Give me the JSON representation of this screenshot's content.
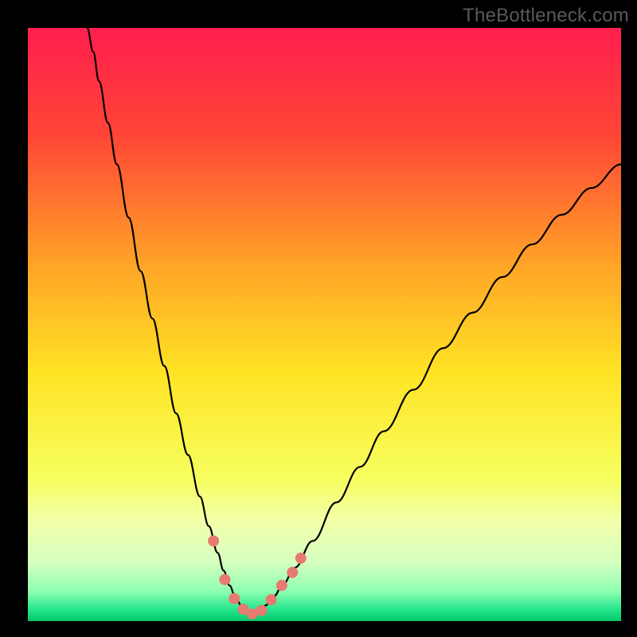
{
  "watermark": {
    "text": "TheBottleneck.com"
  },
  "chart_data": {
    "type": "line",
    "title": "",
    "xlabel": "",
    "ylabel": "",
    "xlim": [
      0,
      100
    ],
    "ylim": [
      0,
      100
    ],
    "gradient_stops": [
      {
        "offset": 0.0,
        "color": "#ff1e4e"
      },
      {
        "offset": 0.18,
        "color": "#ff4536"
      },
      {
        "offset": 0.4,
        "color": "#ffa427"
      },
      {
        "offset": 0.58,
        "color": "#ffe324"
      },
      {
        "offset": 0.76,
        "color": "#f7ff5f"
      },
      {
        "offset": 0.83,
        "color": "#f2ffa8"
      },
      {
        "offset": 0.9,
        "color": "#d6ffc0"
      },
      {
        "offset": 0.95,
        "color": "#8effb0"
      },
      {
        "offset": 0.98,
        "color": "#27e68d"
      },
      {
        "offset": 1.0,
        "color": "#00c86a"
      }
    ],
    "series": [
      {
        "name": "curve-left",
        "color": "#000000",
        "width": 2.2,
        "points": [
          {
            "x": 10.0,
            "y": 100.0
          },
          {
            "x": 11.0,
            "y": 96.0
          },
          {
            "x": 12.0,
            "y": 91.0
          },
          {
            "x": 13.5,
            "y": 84.0
          },
          {
            "x": 15.0,
            "y": 77.0
          },
          {
            "x": 17.0,
            "y": 68.0
          },
          {
            "x": 19.0,
            "y": 59.0
          },
          {
            "x": 21.0,
            "y": 51.0
          },
          {
            "x": 23.0,
            "y": 43.0
          },
          {
            "x": 25.0,
            "y": 35.0
          },
          {
            "x": 27.0,
            "y": 28.0
          },
          {
            "x": 29.0,
            "y": 21.0
          },
          {
            "x": 30.5,
            "y": 16.0
          },
          {
            "x": 32.0,
            "y": 11.5
          },
          {
            "x": 33.0,
            "y": 8.5
          },
          {
            "x": 34.0,
            "y": 6.0
          },
          {
            "x": 35.0,
            "y": 4.0
          },
          {
            "x": 36.0,
            "y": 2.6
          },
          {
            "x": 37.0,
            "y": 1.6
          },
          {
            "x": 38.0,
            "y": 1.2
          }
        ]
      },
      {
        "name": "curve-right",
        "color": "#000000",
        "width": 2.2,
        "points": [
          {
            "x": 38.0,
            "y": 1.2
          },
          {
            "x": 39.0,
            "y": 1.6
          },
          {
            "x": 40.0,
            "y": 2.6
          },
          {
            "x": 41.5,
            "y": 4.2
          },
          {
            "x": 43.0,
            "y": 6.2
          },
          {
            "x": 45.0,
            "y": 9.0
          },
          {
            "x": 48.0,
            "y": 13.5
          },
          {
            "x": 52.0,
            "y": 20.0
          },
          {
            "x": 56.0,
            "y": 26.0
          },
          {
            "x": 60.0,
            "y": 32.0
          },
          {
            "x": 65.0,
            "y": 39.0
          },
          {
            "x": 70.0,
            "y": 46.0
          },
          {
            "x": 75.0,
            "y": 52.0
          },
          {
            "x": 80.0,
            "y": 58.0
          },
          {
            "x": 85.0,
            "y": 63.5
          },
          {
            "x": 90.0,
            "y": 68.5
          },
          {
            "x": 95.0,
            "y": 73.0
          },
          {
            "x": 100.0,
            "y": 77.0
          }
        ]
      }
    ],
    "markers": {
      "color": "#e77a71",
      "radius": 7.0,
      "points": [
        {
          "x": 31.3,
          "y": 13.5
        },
        {
          "x": 33.2,
          "y": 7.0
        },
        {
          "x": 34.8,
          "y": 3.8
        },
        {
          "x": 36.3,
          "y": 2.0
        },
        {
          "x": 37.8,
          "y": 1.2
        },
        {
          "x": 39.4,
          "y": 1.8
        },
        {
          "x": 41.0,
          "y": 3.6
        },
        {
          "x": 42.8,
          "y": 6.0
        },
        {
          "x": 44.6,
          "y": 8.2
        },
        {
          "x": 46.0,
          "y": 10.6
        }
      ]
    }
  }
}
